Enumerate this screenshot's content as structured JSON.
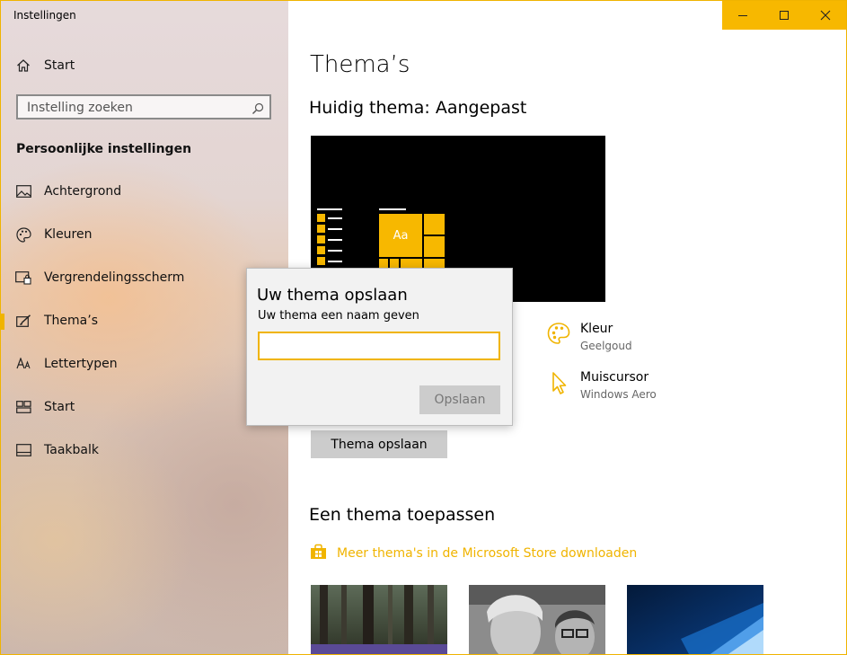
{
  "window": {
    "title": "Instellingen",
    "accent": "#f7b800"
  },
  "sidebar": {
    "home_label": "Start",
    "search_placeholder": "Instelling zoeken",
    "section_title": "Persoonlijke instellingen",
    "items": [
      {
        "label": "Achtergrond",
        "icon": "picture-icon"
      },
      {
        "label": "Kleuren",
        "icon": "palette-icon"
      },
      {
        "label": "Vergrendelingsscherm",
        "icon": "lockscreen-icon"
      },
      {
        "label": "Thema’s",
        "icon": "theme-brush-icon",
        "active": true
      },
      {
        "label": "Lettertypen",
        "icon": "fonts-icon"
      },
      {
        "label": "Start",
        "icon": "start-layout-icon"
      },
      {
        "label": "Taakbalk",
        "icon": "taskbar-icon"
      }
    ]
  },
  "main": {
    "title": "Thema’s",
    "current_theme": "Huidig thema: Aangepast",
    "preview_tile_text": "Aa",
    "properties": [
      {
        "title": "Kleur",
        "value": "Geelgoud",
        "icon": "palette-icon"
      },
      {
        "title": "Muiscursor",
        "value": "Windows Aero",
        "icon": "cursor-icon"
      }
    ],
    "save_theme_button": "Thema opslaan",
    "apply_heading": "Een thema toepassen",
    "store_link": "Meer thema's in de Microsoft Store downloaden"
  },
  "dialog": {
    "title": "Uw thema opslaan",
    "label": "Uw thema een naam geven",
    "input_value": "",
    "save_button": "Opslaan"
  }
}
